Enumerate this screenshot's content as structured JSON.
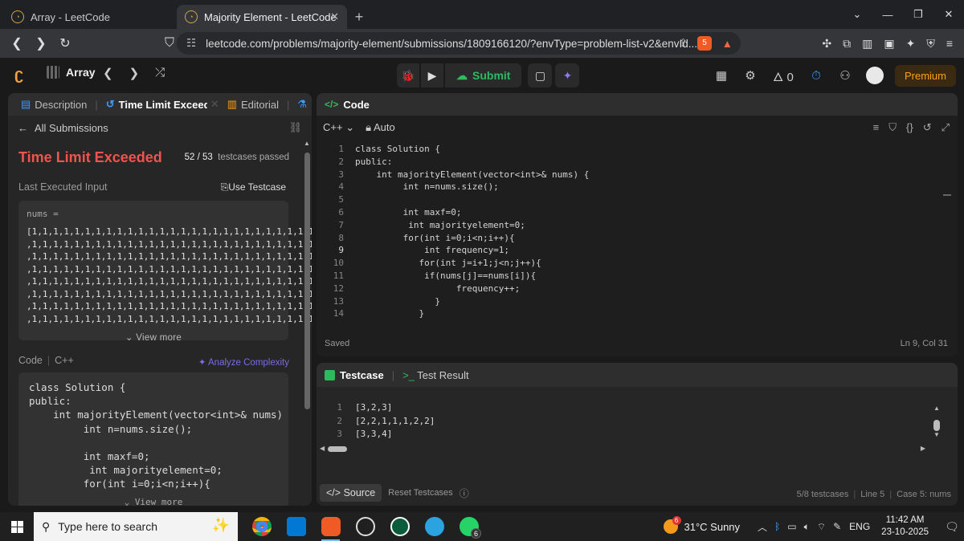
{
  "browser": {
    "tabs": [
      {
        "title": "Array - LeetCode",
        "active": false
      },
      {
        "title": "Majority Element - LeetCode",
        "active": true
      }
    ],
    "url": "leetcode.com/problems/majority-element/submissions/1809166120/?envType=problem-list-v2&envId...",
    "brave_badge": "5"
  },
  "header": {
    "list_name": "Array",
    "submit_label": "Submit",
    "streak": "0",
    "premium_label": "Premium"
  },
  "left": {
    "tabs": [
      {
        "label": "Description",
        "icon": "document-icon"
      },
      {
        "label": "Time Limit Exceeded",
        "icon": "history-icon"
      },
      {
        "label": "Editorial",
        "icon": "book-icon"
      }
    ],
    "all_submissions": "All Submissions",
    "result_title": "Time Limit Exceeded",
    "testcases_count": "52 / 53",
    "testcases_suffix": "testcases passed",
    "last_input_label": "Last Executed Input",
    "use_testcase": "Use Testcase",
    "input_name": "nums =",
    "input_value": "[1,1,1,1,1,1,1,1,1,1,1,1,1,1,1,1,1,1,1,1,1,1,1,1,1,1,1\n,1,1,1,1,1,1,1,1,1,1,1,1,1,1,1,1,1,1,1,1,1,1,1,1,1,1,1\n,1,1,1,1,1,1,1,1,1,1,1,1,1,1,1,1,1,1,1,1,1,1,1,1,1,1,1\n,1,1,1,1,1,1,1,1,1,1,1,1,1,1,1,1,1,1,1,1,1,1,1,1,1,1,1\n,1,1,1,1,1,1,1,1,1,1,1,1,1,1,1,1,1,1,1,1,1,1,1,1,1,1,1\n,1,1,1,1,1,1,1,1,1,1,1,1,1,1,1,1,1,1,1,1,1,1,1,1,1,1,1\n,1,1,1,1,1,1,1,1,1,1,1,1,1,1,1,1,1,1,1,1,1,1,1,1,1,1,1\n,1,1,1,1,1,1,1,1,1,1,1,1,1,1,1,1,1,1,1,1,1,1,1,1,1,1,1",
    "view_more": "View more",
    "code_label": "Code",
    "code_lang": "C++",
    "analyze": "Analyze Complexity",
    "code_preview": "class Solution {\npublic:\n    int majorityElement(vector<int>& nums) {\n         int n=nums.size();\n\n         int maxf=0;\n          int majorityelement=0;\n         for(int i=0;i<n;i++){",
    "view_more_2": "View more"
  },
  "editor": {
    "title": "Code",
    "language": "C++",
    "mode": "Auto",
    "lines": [
      "class Solution {",
      "public:",
      "    int majorityElement(vector<int>& nums) {",
      "         int n=nums.size();",
      "",
      "         int maxf=0;",
      "          int majorityelement=0;",
      "         for(int i=0;i<n;i++){",
      "             int frequency=1;",
      "            for(int j=i+1;j<n;j++){",
      "             if(nums[j]==nums[i]){",
      "                   frequency++;",
      "               }",
      "            }"
    ],
    "line_numbers": [
      "1",
      "2",
      "3",
      "4",
      "5",
      "6",
      "7",
      "8",
      "9",
      "10",
      "11",
      "12",
      "13",
      "14"
    ],
    "status": "Saved",
    "cursor": "Ln 9, Col 31"
  },
  "testcase": {
    "tab_testcase": "Testcase",
    "tab_result": "Test Result",
    "lines": [
      "[3,2,3]",
      "[2,2,1,1,1,2,2]",
      "[3,3,4]"
    ],
    "source": "Source",
    "reset": "Reset Testcases",
    "count": "5/8 testcases",
    "line": "Line 5",
    "case": "Case 5: nums"
  },
  "taskbar": {
    "search_placeholder": "Type here to search",
    "weather": "31°C  Sunny",
    "weather_badge": "6",
    "lang": "ENG",
    "time": "11:42 AM",
    "date": "23-10-2025",
    "whatsapp_badge": "6"
  }
}
